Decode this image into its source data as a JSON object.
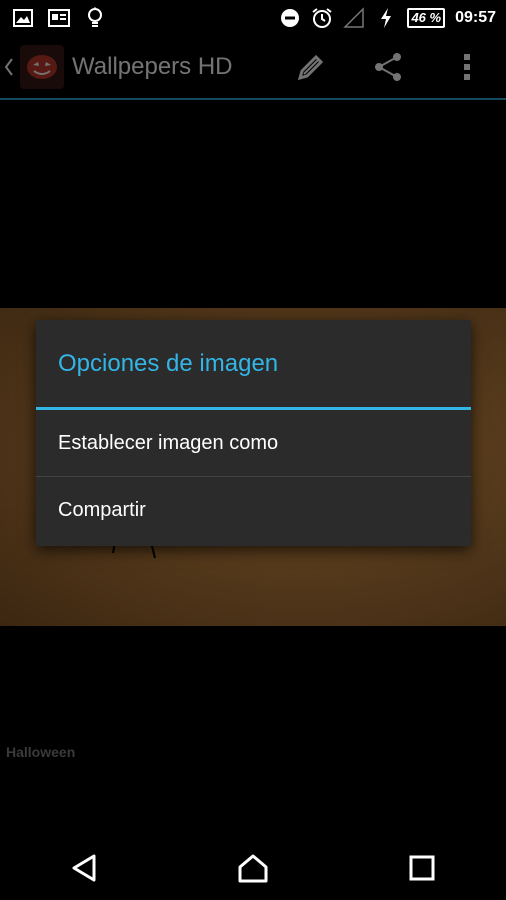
{
  "status_bar": {
    "battery_percent": "46 %",
    "time": "09:57",
    "icons": [
      "image-icon",
      "news-icon",
      "lightbulb-icon",
      "do-not-disturb-icon",
      "alarm-icon",
      "signal-icon",
      "charging-icon",
      "battery-icon"
    ]
  },
  "action_bar": {
    "title": "Wallpepers HD",
    "actions": [
      "edit-icon",
      "share-icon",
      "overflow-menu-icon"
    ]
  },
  "dialog": {
    "title": "Opciones de imagen",
    "items": [
      {
        "label": "Establecer imagen como"
      },
      {
        "label": "Compartir"
      }
    ]
  },
  "caption": "Halloween",
  "nav_bar": {
    "buttons": [
      "back-icon",
      "home-icon",
      "recents-icon"
    ]
  },
  "colors": {
    "accent": "#33b5e5",
    "dialog_bg": "#2b2b2b",
    "background": "#000000"
  }
}
